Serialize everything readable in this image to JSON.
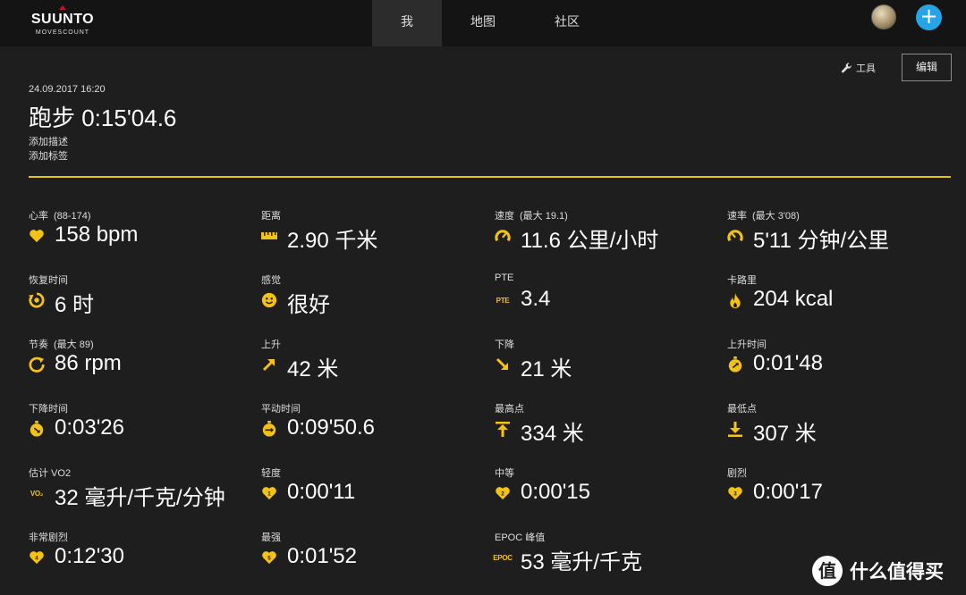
{
  "brand": {
    "name": "SUUNTO",
    "sub": "MOVESCOUNT"
  },
  "nav": [
    {
      "label": "我"
    },
    {
      "label": "地图"
    },
    {
      "label": "社区"
    }
  ],
  "header": {
    "plus": "+",
    "tools_label": "工具",
    "edit_label": "编辑"
  },
  "activity": {
    "datetime": "24.09.2017 16:20",
    "title": "跑步 0:15'04.6",
    "add_description": "添加描述",
    "add_tag": "添加标签"
  },
  "colors": {
    "accent": "#f4c214",
    "divider": "#e2c21a",
    "plus_button": "#27a3e6",
    "background": "#1e1e1e",
    "topbar": "#141414"
  },
  "metrics": [
    {
      "label": "心率",
      "extra": "(88-174)",
      "value": "158 bpm",
      "icon": "heart-icon"
    },
    {
      "label": "距离",
      "extra": "",
      "value": "2.90 千米",
      "icon": "ruler-icon"
    },
    {
      "label": "速度",
      "extra": "(最大  19.1)",
      "value": "11.6 公里/小时",
      "icon": "speedometer-icon"
    },
    {
      "label": "速率",
      "extra": "(最大  3'08)",
      "value": "5'11 分钟/公里",
      "icon": "pace-gauge-icon"
    },
    {
      "label": "恢复时间",
      "extra": "",
      "value": "6 时",
      "icon": "recovery-icon"
    },
    {
      "label": "感觉",
      "extra": "",
      "value": "很好",
      "icon": "smiley-icon"
    },
    {
      "label": "PTE",
      "extra": "",
      "value": "3.4",
      "icon": "pte-icon",
      "tag": "PTE"
    },
    {
      "label": "卡路里",
      "extra": "",
      "value": "204 kcal",
      "icon": "flame-icon"
    },
    {
      "label": "节奏",
      "extra": "(最大  89)",
      "value": "86 rpm",
      "icon": "cadence-icon"
    },
    {
      "label": "上升",
      "extra": "",
      "value": "42 米",
      "icon": "arrow-up-right-icon"
    },
    {
      "label": "下降",
      "extra": "",
      "value": "21 米",
      "icon": "arrow-down-right-icon"
    },
    {
      "label": "上升时间",
      "extra": "",
      "value": "0:01'48",
      "icon": "stopwatch-up-icon"
    },
    {
      "label": "下降时间",
      "extra": "",
      "value": "0:03'26",
      "icon": "stopwatch-down-icon"
    },
    {
      "label": "平动时间",
      "extra": "",
      "value": "0:09'50.6",
      "icon": "stopwatch-flat-icon"
    },
    {
      "label": "最高点",
      "extra": "",
      "value": "334 米",
      "icon": "highest-point-icon"
    },
    {
      "label": "最低点",
      "extra": "",
      "value": "307 米",
      "icon": "lowest-point-icon"
    },
    {
      "label": "估计 VO2",
      "extra": "",
      "value": "32 毫升/千克/分钟",
      "icon": "vo2-icon",
      "tag": "VO₂"
    },
    {
      "label": "轻度",
      "extra": "",
      "value": "0:00'11",
      "icon": "heart-zone-1-icon"
    },
    {
      "label": "中等",
      "extra": "",
      "value": "0:00'15",
      "icon": "heart-zone-2-icon"
    },
    {
      "label": "剧烈",
      "extra": "",
      "value": "0:00'17",
      "icon": "heart-zone-3-icon"
    },
    {
      "label": "非常剧烈",
      "extra": "",
      "value": "0:12'30",
      "icon": "heart-zone-4-icon"
    },
    {
      "label": "最强",
      "extra": "",
      "value": "0:01'52",
      "icon": "heart-zone-5-icon"
    },
    {
      "label": "EPOC 峰值",
      "extra": "",
      "value": "53 毫升/千克",
      "icon": "epoc-icon",
      "tag": "EPOC"
    }
  ],
  "watermark": {
    "glyph": "值",
    "text": "什么值得买"
  }
}
